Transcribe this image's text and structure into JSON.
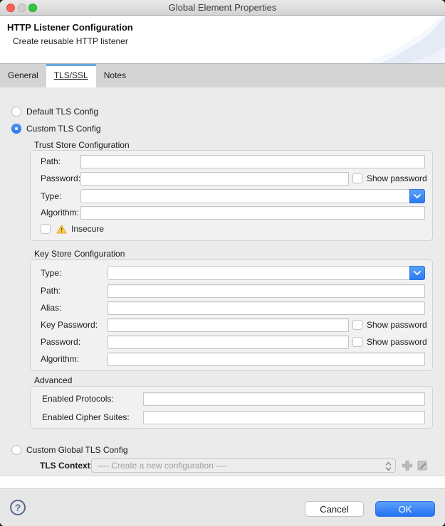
{
  "window": {
    "title": "Global Element Properties"
  },
  "header": {
    "title": "HTTP Listener Configuration",
    "subtitle": "Create reusable HTTP listener"
  },
  "tabs": [
    {
      "label": "General",
      "active": false
    },
    {
      "label": "TLS/SSL",
      "active": true
    },
    {
      "label": "Notes",
      "active": false
    }
  ],
  "radios": {
    "default_label": "Default TLS Config",
    "custom_label": "Custom TLS Config",
    "custom_global_label": "Custom Global TLS Config"
  },
  "trust_store": {
    "title": "Trust Store Configuration",
    "path_label": "Path:",
    "password_label": "Password:",
    "show_password_label": "Show password",
    "type_label": "Type:",
    "algorithm_label": "Algorithm:",
    "insecure_label": "Insecure"
  },
  "key_store": {
    "title": "Key Store Configuration",
    "type_label": "Type:",
    "path_label": "Path:",
    "alias_label": "Alias:",
    "key_password_label": "Key Password:",
    "password_label": "Password:",
    "algorithm_label": "Algorithm:",
    "show_password_label": "Show password"
  },
  "advanced": {
    "title": "Advanced",
    "enabled_protocols_label": "Enabled Protocols:",
    "enabled_cipher_suites_label": "Enabled Cipher Suites:"
  },
  "tls_context": {
    "label": "TLS Context:",
    "value": "---- Create a new configuration ----"
  },
  "footer": {
    "help_label": "?",
    "cancel_label": "Cancel",
    "ok_label": "OK"
  },
  "icons": {
    "warning": "warning-triangle",
    "combo_dropdown": "chevron-down",
    "context_stepper": "up-down-chevrons",
    "add": "plus",
    "edit": "edit-pencil",
    "help": "question-mark"
  },
  "colors": {
    "accent_blue": "#2b7af2",
    "tab_highlight": "#66a9da",
    "warning_fill": "#fbd34d",
    "warning_stroke": "#dd9f1b",
    "ok_button": "#2173f3"
  }
}
